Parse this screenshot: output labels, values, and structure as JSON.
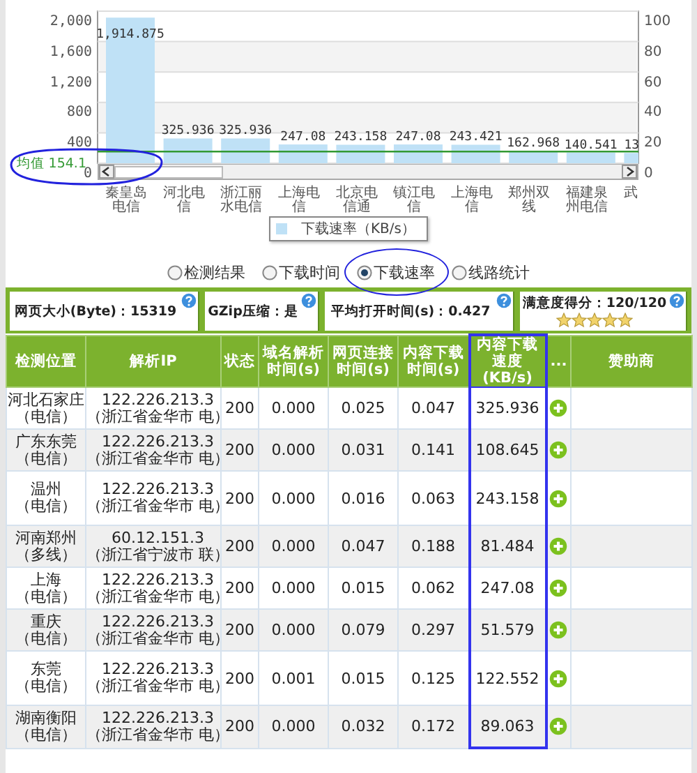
{
  "chart": {
    "chart_data": {
      "type": "bar",
      "categories": [
        "秦皇岛电信",
        "河北电信",
        "浙江丽水电信",
        "上海电信",
        "北京电信通",
        "镇江电信",
        "上海电信",
        "郑州双线",
        "福建泉州电信",
        "武"
      ],
      "series": [
        {
          "name": "下载速率（KB/s）",
          "color": "#bfe1f6",
          "values": [
            1914.875,
            325.936,
            325.936,
            247.08,
            243.158,
            247.08,
            243.421,
            162.968,
            140.541,
            135
          ]
        }
      ],
      "ylim": [
        0,
        2000
      ],
      "yticks": [
        {
          "value": 0,
          "label": "0"
        },
        {
          "value": 400,
          "label": "400"
        },
        {
          "value": 800,
          "label": "800"
        },
        {
          "value": 1200,
          "label": "1,200"
        },
        {
          "value": 1600,
          "label": "1,600"
        },
        {
          "value": 2000,
          "label": "2,000"
        }
      ],
      "grid": true,
      "value_labels": [
        "1,914.875",
        "325.936",
        "325.936",
        "247.08",
        "243.158",
        "247.08",
        "243.421",
        "162.968",
        "140.541",
        "13"
      ],
      "ref_lines": [
        {
          "axis": "y",
          "value": 154.1,
          "label": "均值 154.1",
          "color": "#339933"
        }
      ]
    },
    "right_axis_ticks": [
      "100",
      "80",
      "60",
      "40",
      "20",
      "0"
    ]
  },
  "radios": [
    {
      "label": "检测结果",
      "selected": false
    },
    {
      "label": "下载时间",
      "selected": false
    },
    {
      "label": "下载速率",
      "selected": true
    },
    {
      "label": "线路统计",
      "selected": false
    }
  ],
  "summary": [
    {
      "kind": "stat",
      "label": "网页大小(Byte)：",
      "value": "15319"
    },
    {
      "kind": "stat",
      "label": "GZip压缩：",
      "value": "是"
    },
    {
      "kind": "stat",
      "label": "平均打开时间(s)：",
      "value": "0.427"
    },
    {
      "kind": "score",
      "label": "满意度得分：",
      "value": "120/120",
      "stars": 5
    }
  ],
  "table": {
    "columns": [
      {
        "label": "检测位置",
        "highlighted": false
      },
      {
        "label": "解析IP",
        "highlighted": false
      },
      {
        "label": "状态",
        "highlighted": false
      },
      {
        "label": "域名解析时间(s)",
        "highlighted": false
      },
      {
        "label": "网页连接时间(s)",
        "highlighted": false
      },
      {
        "label": "内容下载时间(s)",
        "highlighted": false
      },
      {
        "label": "内容下载速度(KB/s)",
        "highlighted": true
      },
      {
        "label": "...",
        "highlighted": false
      },
      {
        "label": "赞助商",
        "highlighted": false
      }
    ],
    "rows": [
      {
        "location": "河北石家庄",
        "line": "（电信）",
        "ip": "122.226.213.3",
        "ip_location": "（浙江省金华市 电）",
        "status": "200",
        "dns": "0.000",
        "connect": "0.025",
        "download_time": "0.047",
        "speed": "325.936"
      },
      {
        "location": "广东东莞",
        "line": "（电信）",
        "ip": "122.226.213.3",
        "ip_location": "（浙江省金华市 电）",
        "status": "200",
        "dns": "0.000",
        "connect": "0.031",
        "download_time": "0.141",
        "speed": "108.645"
      },
      {
        "location": "温州",
        "line": "（电信）",
        "ip": "122.226.213.3",
        "ip_location": "（浙江省金华市 电）",
        "status": "200",
        "dns": "0.000",
        "connect": "0.016",
        "download_time": "0.063",
        "speed": "243.158"
      },
      {
        "location": "河南郑州",
        "line": "（多线）",
        "ip": "60.12.151.3",
        "ip_location": "（浙江省宁波市 联）",
        "status": "200",
        "dns": "0.000",
        "connect": "0.047",
        "download_time": "0.188",
        "speed": "81.484"
      },
      {
        "location": "上海",
        "line": "（电信）",
        "ip": "122.226.213.3",
        "ip_location": "（浙江省金华市 电）",
        "status": "200",
        "dns": "0.000",
        "connect": "0.015",
        "download_time": "0.062",
        "speed": "247.08"
      },
      {
        "location": "重庆",
        "line": "（电信）",
        "ip": "122.226.213.3",
        "ip_location": "（浙江省金华市 电）",
        "status": "200",
        "dns": "0.000",
        "connect": "0.079",
        "download_time": "0.297",
        "speed": "51.579"
      },
      {
        "location": "东莞",
        "line": "（电信）",
        "ip": "122.226.213.3",
        "ip_location": "（浙江省金华市 电）",
        "status": "200",
        "dns": "0.001",
        "connect": "0.015",
        "download_time": "0.125",
        "speed": "122.552"
      },
      {
        "location": "湖南衡阳",
        "line": "（电信）",
        "ip": "122.226.213.3",
        "ip_location": "（浙江省金华市 电）",
        "status": "200",
        "dns": "0.000",
        "connect": "0.032",
        "download_time": "0.172",
        "speed": "89.063"
      }
    ]
  }
}
